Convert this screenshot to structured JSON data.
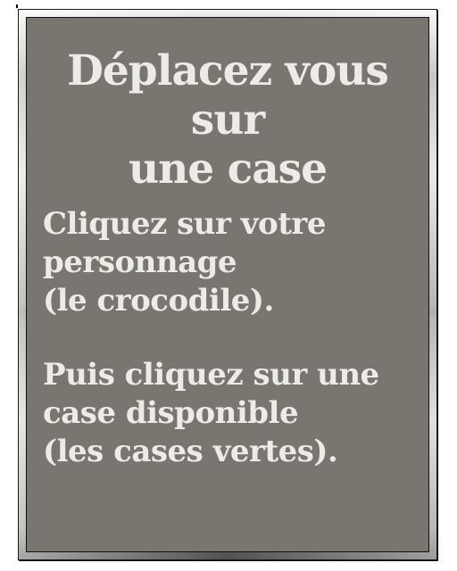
{
  "dialog": {
    "title_lines": [
      "Déplacez vous sur",
      "une case"
    ],
    "step1_lines": [
      "Cliquez sur votre",
      "personnage",
      "(le crocodile)."
    ],
    "step2_lines": [
      "Puis cliquez sur une",
      "case disponible",
      "(les cases vertes)."
    ]
  },
  "colors": {
    "panel_background": "#797670",
    "text": "#ecebe8",
    "frame": "#9c9c9c"
  }
}
